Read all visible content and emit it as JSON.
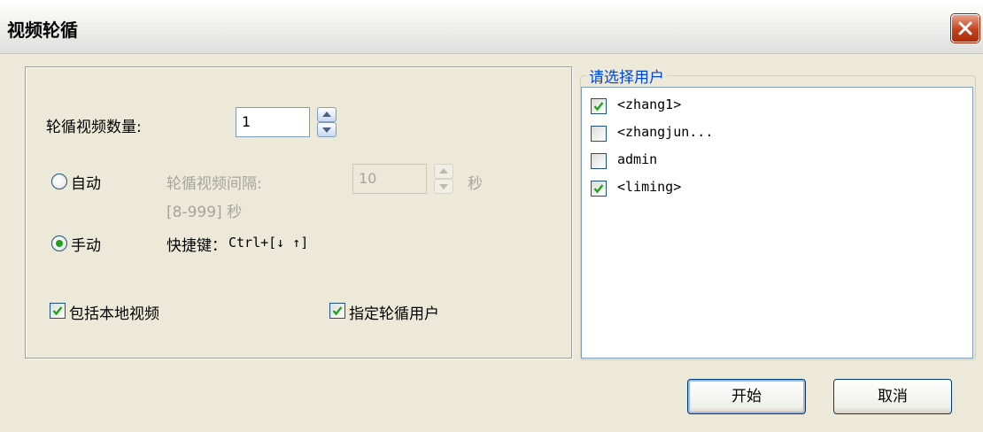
{
  "window": {
    "title": "视频轮循"
  },
  "settings": {
    "count_label": "轮循视频数量:",
    "count_value": "1",
    "auto_label": "自动",
    "interval_label": "轮循视频间隔:",
    "interval_value": "10",
    "interval_unit": "秒",
    "interval_range": "[8-999] 秒",
    "manual_label": "手动",
    "hotkey_label": "快捷键：",
    "hotkey_value": "Ctrl+[↓ ↑]",
    "mode_selected": "手动",
    "include_local_label": "包括本地视频",
    "include_local_checked": true,
    "specify_users_label": "指定轮循用户",
    "specify_users_checked": true
  },
  "user_group": {
    "title": "请选择用户",
    "users": [
      {
        "name": "<zhang1>",
        "checked": true
      },
      {
        "name": "<zhangjun...",
        "checked": false
      },
      {
        "name": "admin",
        "checked": false
      },
      {
        "name": "<liming>",
        "checked": true
      }
    ]
  },
  "buttons": {
    "start": "开始",
    "cancel": "取消"
  }
}
